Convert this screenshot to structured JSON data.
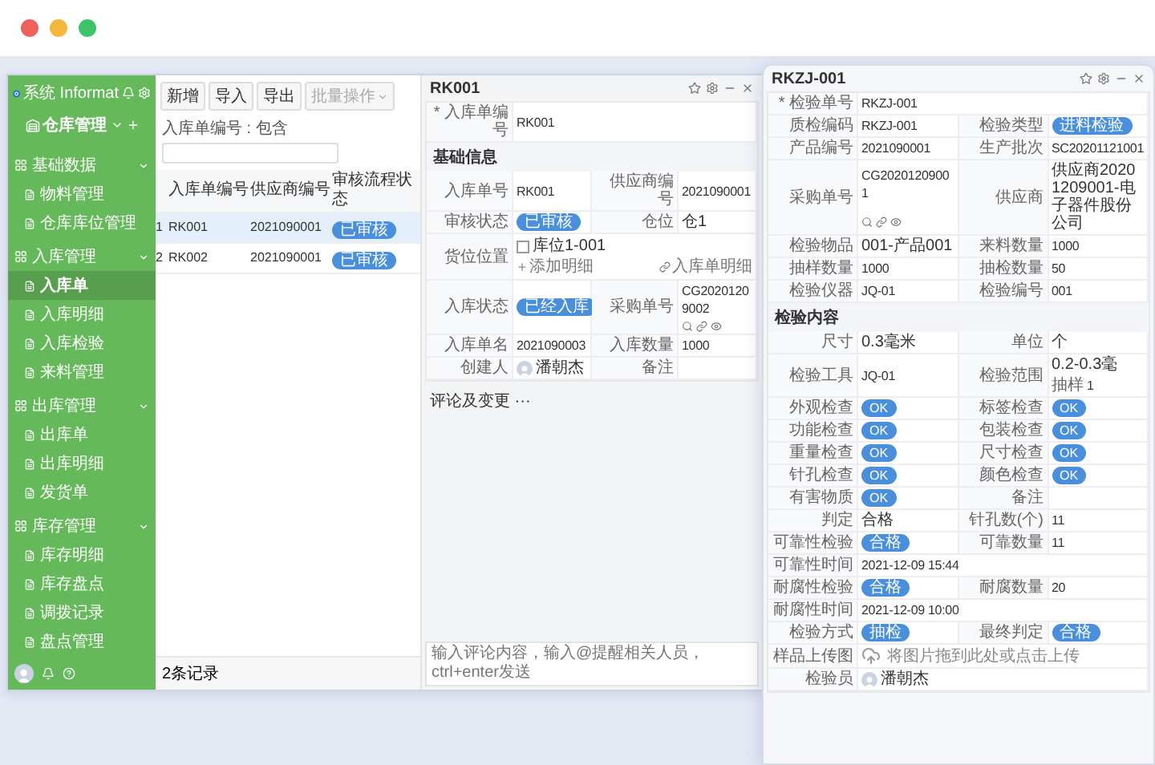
{
  "sidebar": {
    "brand": "系统 Informat",
    "app_title": "仓库管理",
    "groups": [
      {
        "label": "基础数据",
        "expanded": true,
        "items": [
          {
            "label": "物料管理",
            "selected": false
          },
          {
            "label": "仓库库位管理",
            "selected": false
          }
        ]
      },
      {
        "label": "入库管理",
        "expanded": true,
        "items": [
          {
            "label": "入库单",
            "selected": true
          },
          {
            "label": "入库明细",
            "selected": false
          },
          {
            "label": "入库检验",
            "selected": false
          },
          {
            "label": "来料管理",
            "selected": false
          }
        ]
      },
      {
        "label": "出库管理",
        "expanded": true,
        "items": [
          {
            "label": "出库单",
            "selected": false
          },
          {
            "label": "出库明细",
            "selected": false
          },
          {
            "label": "发货单",
            "selected": false
          }
        ]
      },
      {
        "label": "库存管理",
        "expanded": true,
        "items": [
          {
            "label": "库存明细",
            "selected": false
          },
          {
            "label": "库存盘点",
            "selected": false
          },
          {
            "label": "调拨记录",
            "selected": false
          },
          {
            "label": "盘点管理",
            "selected": false
          }
        ]
      }
    ]
  },
  "list": {
    "toolbar": [
      {
        "label": "新增",
        "kind": "button",
        "disabled": false
      },
      {
        "label": "导入",
        "kind": "button",
        "disabled": false
      },
      {
        "label": "导出",
        "kind": "button",
        "disabled": false
      },
      {
        "label": "批量操作",
        "kind": "dropdown",
        "disabled": true
      }
    ],
    "filter": {
      "label": "入库单编号 : 包含"
    },
    "columns": [
      "入库单编号",
      "供应商编号",
      "审核流程状态"
    ],
    "rows": [
      {
        "index": "1",
        "cells": [
          "RK001",
          "2021090001"
        ],
        "status": "已审核",
        "selected": true
      },
      {
        "index": "2",
        "cells": [
          "RK002",
          "2021090001"
        ],
        "status": "已审核",
        "selected": false
      }
    ],
    "footer": "2条记录"
  },
  "record": {
    "title": "RK001",
    "top_field": {
      "label": "* 入库单编号",
      "value": "RK001"
    },
    "sections": [
      {
        "title": "基础信息",
        "rows": [
          [
            {
              "label": "入库单号",
              "value": "RK001",
              "kind": "text"
            },
            {
              "label": "供应商编号",
              "value": "2021090001",
              "kind": "text"
            }
          ],
          [
            {
              "label": "审核状态",
              "value": "已审核",
              "kind": "tag"
            },
            {
              "label": "仓位",
              "value": "仓1",
              "kind": "text"
            }
          ],
          [
            {
              "label": "货位位置",
              "kind": "location",
              "checkbox_label": "库位1-001",
              "checked": false,
              "add_label": "添加明细",
              "link_label": "入库单明细"
            }
          ],
          [
            {
              "label": "入库状态",
              "value": "已经入库",
              "kind": "tag"
            },
            {
              "label": "采购单号",
              "value": "CG20201209002",
              "kind": "lookup"
            }
          ],
          [
            {
              "label": "入库单名",
              "value": "2021090003",
              "kind": "text"
            },
            {
              "label": "入库数量",
              "value": "1000",
              "kind": "text"
            }
          ],
          [
            {
              "label": "创建人",
              "value": "潘朝杰",
              "kind": "user"
            },
            {
              "label": "备注",
              "kind": "text"
            }
          ]
        ]
      }
    ],
    "comments": {
      "title": "评论及变更 ···",
      "placeholder": "输入评论内容，输入@提醒相关人员，ctrl+enter发送"
    }
  },
  "inspection": {
    "title": "RKZJ-001",
    "top_field": {
      "label": "* 检验单号",
      "value": "RKZJ-001"
    },
    "sections": [
      {
        "rows": [
          [
            {
              "label": "质检编码",
              "value": "RKZJ-001",
              "kind": "text"
            },
            {
              "label": "检验类型",
              "value": "进料检验",
              "kind": "tag"
            }
          ],
          [
            {
              "label": "产品编号",
              "value": "2021090001",
              "kind": "text"
            },
            {
              "label": "生产批次",
              "value": "SC20201121001",
              "kind": "text"
            }
          ],
          [
            {
              "label": "采购单号",
              "value": "CG20201209001",
              "kind": "lookup"
            },
            {
              "label": "供应商",
              "value": "供应商20201209001-电子器件股份公司",
              "kind": "text"
            }
          ],
          [
            {
              "label": "检验物品",
              "value": "001-产品001",
              "kind": "text"
            },
            {
              "label": "来料数量",
              "value": "1000",
              "kind": "text"
            }
          ],
          [
            {
              "label": "抽样数量",
              "value": "1000",
              "kind": "text"
            },
            {
              "label": "抽检数量",
              "value": "50",
              "kind": "text"
            }
          ],
          [
            {
              "label": "检验仪器",
              "value": "JQ-01",
              "kind": "text"
            },
            {
              "label": "检验编号",
              "value": "001",
              "kind": "text"
            }
          ]
        ]
      },
      {
        "title": "检验内容",
        "rows": [
          [
            {
              "label": "尺寸",
              "value": "0.3毫米",
              "kind": "text"
            },
            {
              "label": "单位",
              "value": "个",
              "kind": "text"
            }
          ],
          [
            {
              "label": "检验工具",
              "value": "JQ-01",
              "kind": "text"
            },
            {
              "label": "检验范围",
              "value": "0.2-0.3毫",
              "kind": "range",
              "extra_label": "抽样",
              "extra_value": "1"
            }
          ],
          [
            {
              "label": "外观检查",
              "value": "OK",
              "kind": "tag"
            },
            {
              "label": "标签检查",
              "value": "OK",
              "kind": "tag"
            }
          ],
          [
            {
              "label": "功能检查",
              "value": "OK",
              "kind": "tag"
            },
            {
              "label": "包装检查",
              "value": "OK",
              "kind": "tag"
            }
          ],
          [
            {
              "label": "重量检查",
              "value": "OK",
              "kind": "tag"
            },
            {
              "label": "尺寸检查",
              "value": "OK",
              "kind": "tag"
            }
          ],
          [
            {
              "label": "针孔检查",
              "value": "OK",
              "kind": "tag"
            },
            {
              "label": "颜色检查",
              "value": "OK",
              "kind": "tag"
            }
          ],
          [
            {
              "label": "有害物质",
              "value": "OK",
              "kind": "tag"
            },
            {
              "label": "备注",
              "kind": "text"
            }
          ],
          [
            {
              "label": "判定",
              "value": "合格",
              "kind": "text"
            },
            {
              "label": "针孔数(个)",
              "value": "11",
              "kind": "text"
            }
          ],
          [
            {
              "label": "可靠性检验",
              "value": "合格",
              "kind": "tag"
            },
            {
              "label": "可靠数量",
              "value": "11",
              "kind": "text"
            }
          ],
          [
            {
              "label": "可靠性时间",
              "value": "2021-12-09 15:44",
              "kind": "text"
            }
          ],
          [
            {
              "label": "耐腐性检验",
              "value": "合格",
              "kind": "tag"
            },
            {
              "label": "耐腐数量",
              "value": "20",
              "kind": "text"
            }
          ],
          [
            {
              "label": "耐腐性时间",
              "value": "2021-12-09 10:00",
              "kind": "text"
            }
          ],
          [
            {
              "label": "检验方式",
              "value": "抽检",
              "kind": "tag"
            },
            {
              "label": "最终判定",
              "value": "合格",
              "kind": "tag"
            }
          ],
          [
            {
              "label": "样品上传图",
              "hint": "将图片拖到此处或点击上传",
              "kind": "upload"
            }
          ],
          [
            {
              "label": "检验员",
              "value": "潘朝杰",
              "kind": "user"
            }
          ]
        ]
      }
    ]
  }
}
